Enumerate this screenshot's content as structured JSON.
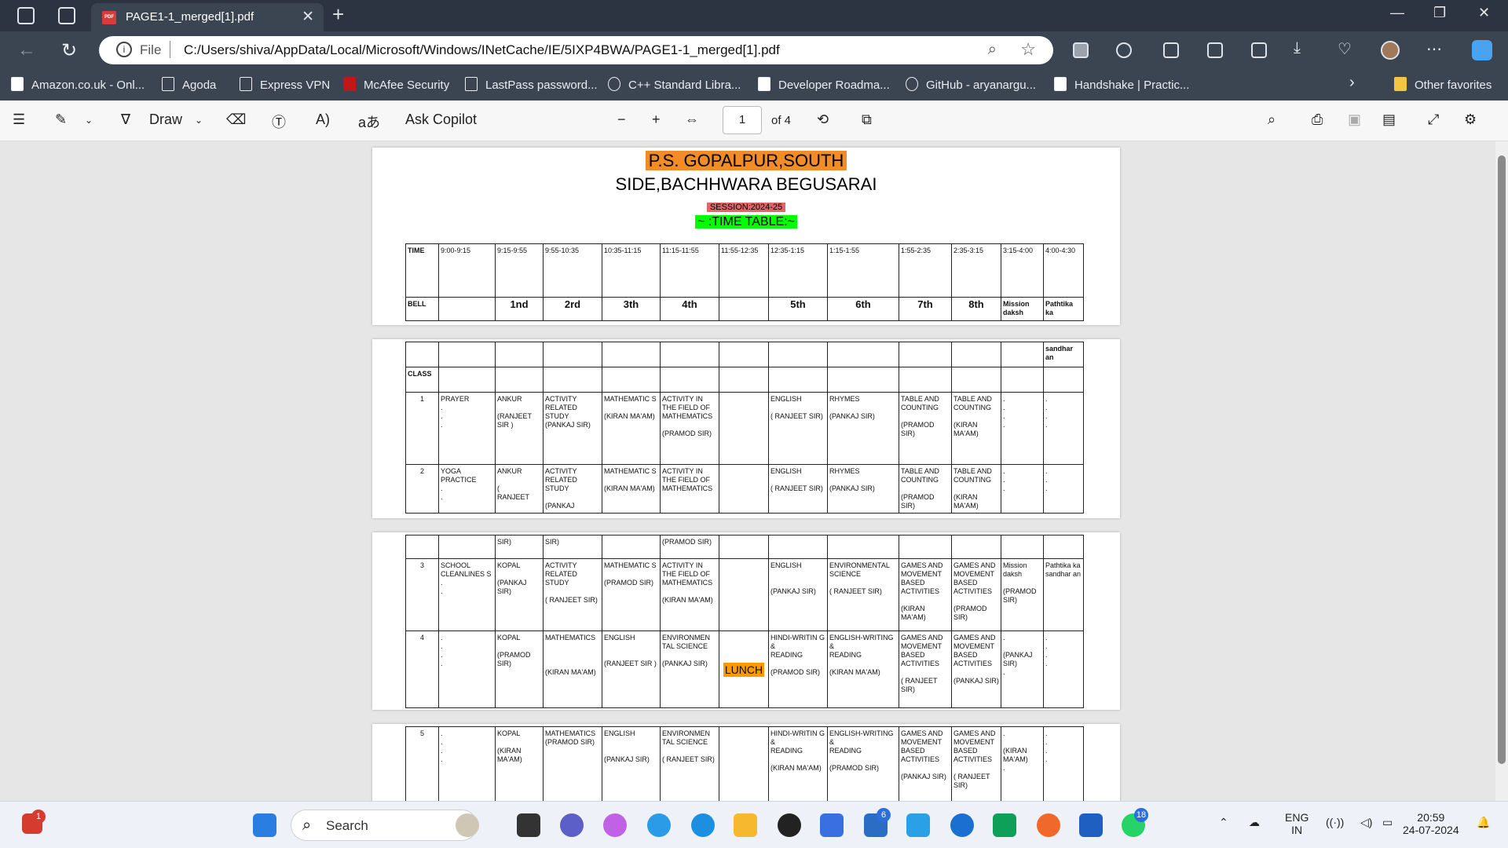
{
  "browser": {
    "tab_title": "PAGE1-1_merged[1].pdf",
    "file_label": "File",
    "url": "C:/Users/shiva/AppData/Local/Microsoft/Windows/INetCache/IE/5IXP4BWA/PAGE1-1_merged[1].pdf",
    "bookmarks": [
      "Amazon.co.uk - Onl...",
      "Agoda",
      "Express VPN",
      "McAfee Security",
      "LastPass password...",
      "C++ Standard Libra...",
      "Developer Roadma...",
      "GitHub - aryanargu...",
      "Handshake | Practic..."
    ],
    "other_favorites": "Other favorites"
  },
  "pdf_toolbar": {
    "draw": "Draw",
    "ask_copilot": "Ask Copilot",
    "page": "1",
    "of_pages": "of 4"
  },
  "document": {
    "school_line1": "P.S. GOPALPUR,SOUTH",
    "school_line2": "SIDE,BACHHWARA BEGUSARAI",
    "session": "SESSION:2024-25",
    "timetable": "~ :TIME TABLE:~",
    "time_label": "TIME",
    "times": [
      "9:00-9:15",
      "9:15-9:55",
      "9:55-10:35",
      "10:35-11:15",
      "11:15-11:55",
      "11:55-12:35",
      "12:35-1:15",
      "1:15-1:55",
      "1:55-2:35",
      "2:35-3:15",
      "3:15-4:00",
      "4:00-4:30"
    ],
    "bell_label": "BELL",
    "bells": [
      "",
      "1nd",
      "2rd",
      "3th",
      "4th",
      "",
      "5th",
      "6th",
      "7th",
      "8th",
      "Mission daksh",
      "Pathtika ka"
    ],
    "sandharan": "sandhar an",
    "class_label": "CLASS",
    "lunch": "LUNCH",
    "row1": [
      "1",
      "PRAYER\n.\n.\n.",
      "ANKUR\n\n(RANJEET SIR )",
      "ACTIVITY RELATED STUDY\n(PANKAJ SIR)",
      "MATHEMATIC S\n\n(KIRAN MA'AM)",
      "ACTIVITY IN THE FIELD OF MATHEMATICS\n\n(PRAMOD SIR)",
      "",
      "ENGLISH\n\n( RANJEET SIR)",
      "RHYMES\n\n(PANKAJ SIR)",
      "TABLE AND COUNTING\n\n(PRAMOD SIR)",
      "TABLE AND COUNTING\n\n(KIRAN MA'AM)",
      ".\n.\n.\n.",
      ".\n.\n.\n."
    ],
    "row2": [
      "2",
      "YOGA PRACTICE\n.\n.",
      "ANKUR\n\n(\nRANJEET",
      "ACTIVITY RELATED STUDY\n\n(PANKAJ",
      "MATHEMATIC S\n\n(KIRAN MA'AM)",
      "ACTIVITY IN THE FIELD OF MATHEMATICS",
      "",
      "ENGLISH\n\n( RANJEET SIR)",
      "RHYMES\n\n(PANKAJ SIR)",
      "TABLE AND COUNTING\n\n(PRAMOD SIR)",
      "TABLE AND COUNTING\n\n(KIRAN MA'AM)",
      ".\n.\n.",
      ".\n.\n."
    ],
    "row2cont": [
      "",
      "",
      "SIR)",
      "SIR)",
      "",
      "(PRAMOD SIR)",
      "",
      "",
      "",
      "",
      "",
      "",
      ""
    ],
    "row3": [
      "3",
      "SCHOOL CLEANLINES S\n.\n.",
      "KOPAL\n\n(PANKAJ SIR)",
      "ACTIVITY RELATED STUDY\n\n( RANJEET SIR)",
      "MATHEMATIC S\n\n(PRAMOD SIR)",
      "ACTIVITY IN THE FIELD OF MATHEMATICS\n\n(KIRAN MA'AM)",
      "",
      "ENGLISH\n\n\n(PANKAJ SIR)",
      "ENVIRONMENTAL SCIENCE\n\n( RANJEET SIR)",
      "GAMES AND MOVEMENT BASED ACTIVITIES\n\n(KIRAN MA'AM)",
      "GAMES AND MOVEMENT BASED ACTIVITIES\n\n(PRAMOD SIR)",
      "Mission daksh\n\n(PRAMOD SIR)",
      "Pathtika ka sandhar an"
    ],
    "row4": [
      "4",
      ".\n.\n.\n.",
      "KOPAL\n\n(PRAMOD SIR)",
      "MATHEMATICS\n\n\n\n(KIRAN MA'AM)",
      "ENGLISH\n\n\n(RANJEET SIR )",
      "ENVIRONMEN TAL SCIENCE\n\n(PANKAJ SIR)",
      "LUNCH",
      "HINDI-WRITIN G\n&\nREADING\n\n(PRAMOD SIR)",
      "ENGLISH-WRITING &\nREADING\n\n(KIRAN MA'AM)",
      "GAMES AND MOVEMENT BASED ACTIVITIES\n\n( RANJEET SIR)",
      "GAMES AND MOVEMENT BASED ACTIVITIES\n\n(PANKAJ SIR)",
      ".\n\n(PANKAJ SIR)\n.",
      ".\n.\n.\n."
    ],
    "row5": [
      "5",
      ".\n.\n.\n.",
      "KOPAL\n\n(KIRAN MA'AM)",
      "MATHEMATICS\n(PRAMOD SIR)",
      "ENGLISH\n\n\n(PANKAJ SIR)",
      "ENVIRONMEN TAL SCIENCE\n\n( RANJEET SIR)",
      "",
      "HINDI-WRITIN G\n&\nREADING\n\n(KIRAN MA'AM)",
      "ENGLISH-WRITING &\nREADING\n\n(PRAMOD SIR)",
      "GAMES AND MOVEMENT BASED ACTIVITIES\n\n(PANKAJ SIR)",
      "GAMES AND MOVEMENT BASED ACTIVITIES\n\n( RANJEET SIR)",
      ".\n\n(KIRAN MA'AM)\n.",
      ".\n.\n.\n."
    ]
  },
  "taskbar": {
    "search": "Search",
    "lang1": "ENG",
    "lang2": "IN",
    "time": "20:59",
    "date": "24-07-2024",
    "badge_edge": "6",
    "badge_whatsapp": "18",
    "badge_left": "1"
  },
  "colors": {
    "orange": "#f28c28",
    "lunch": "#ff9900",
    "session": "#e06666",
    "green": "#00ff00"
  }
}
